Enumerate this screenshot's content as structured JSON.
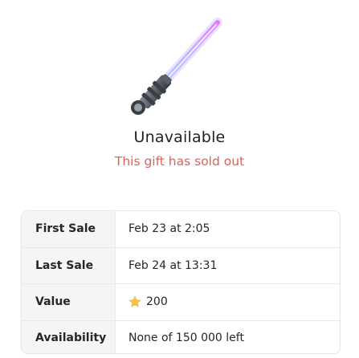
{
  "gift": {
    "image_icon": "lightsaber-icon"
  },
  "status": {
    "title": "Unavailable",
    "subtitle": "This gift has sold out"
  },
  "info": [
    {
      "label": "First Sale",
      "value": "Feb 23 at 2:05"
    },
    {
      "label": "Last Sale",
      "value": "Feb 24 at 13:31"
    },
    {
      "label": "Value",
      "value": "200",
      "icon": "star-icon"
    },
    {
      "label": "Availability",
      "value": "None of 150 000 left"
    }
  ],
  "colors": {
    "subtitle": "#d8625f",
    "star": "#f5c542",
    "label_bg": "#f5f5f5"
  }
}
